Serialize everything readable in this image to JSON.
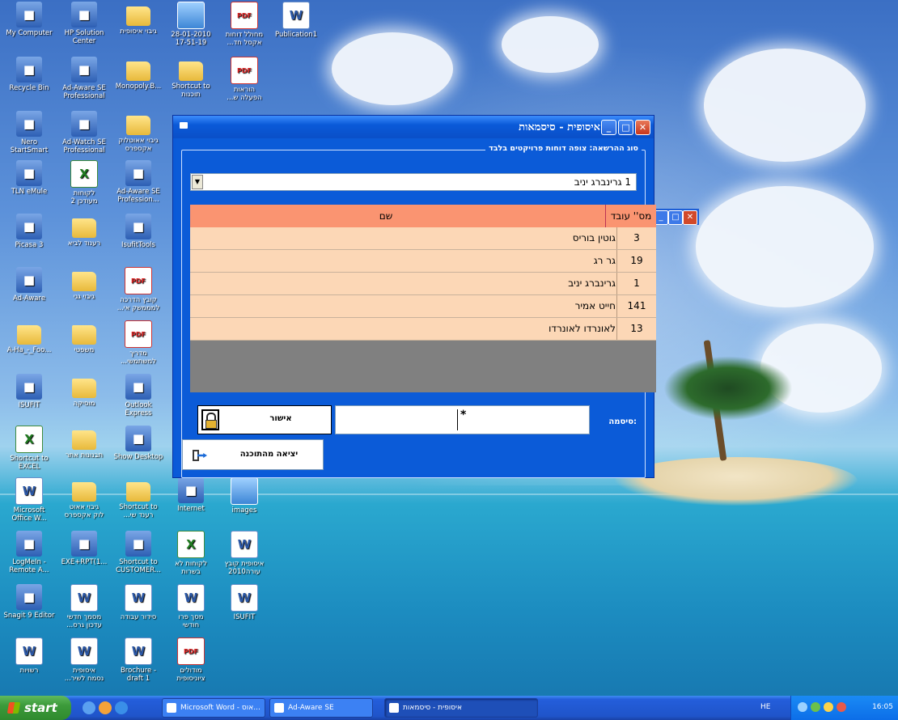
{
  "desktop": {
    "icons": [
      {
        "label": "My Computer",
        "kind": "app"
      },
      {
        "label": "HP Solution\nCenter",
        "kind": "app"
      },
      {
        "label": "גיבוי איסופית",
        "kind": "folder"
      },
      {
        "label": "28-01-2010\n17-51-19",
        "kind": "image"
      },
      {
        "label": "מחולל דוחות\n...אקסל חד",
        "kind": "pdf"
      },
      {
        "label": "Publication1",
        "kind": "doc"
      },
      {
        "label": "Recycle Bin",
        "kind": "app"
      },
      {
        "label": "Ad-Aware SE\nProfessional",
        "kind": "app"
      },
      {
        "label": "Monopoly.B...",
        "kind": "folder"
      },
      {
        "label": "Shortcut to\nתוכנות",
        "kind": "folder"
      },
      {
        "label": "הוראות\n...הפעלה ש",
        "kind": "pdf"
      },
      {
        "label": "Nero\nStartSmart",
        "kind": "app"
      },
      {
        "label": "Ad-Watch SE\nProfessional",
        "kind": "app"
      },
      {
        "label": "גיבוי אאוטלוק\nאקספרס",
        "kind": "folder"
      },
      {
        "label": "TLN eMule",
        "kind": "app"
      },
      {
        "label": "לקוחות\nמעודכן 2",
        "kind": "excel"
      },
      {
        "label": "Ad-Aware SE\nProfession...",
        "kind": "app"
      },
      {
        "label": "Picasa 3",
        "kind": "app"
      },
      {
        "label": "רענוד לביא",
        "kind": "folder"
      },
      {
        "label": "IsufitTools",
        "kind": "app"
      },
      {
        "label": "Ad-Aware",
        "kind": "app"
      },
      {
        "label": "גיבוי גגי",
        "kind": "folder"
      },
      {
        "label": "קובץ הדרכה\n...למממשק אי",
        "kind": "pdf"
      },
      {
        "label": "A-Ha_-_Foo...",
        "kind": "folder"
      },
      {
        "label": "משפטי",
        "kind": "folder"
      },
      {
        "label": "מדריך\n...למשתמשי",
        "kind": "pdf"
      },
      {
        "label": "ISUFIT",
        "kind": "app"
      },
      {
        "label": "מוסיקה",
        "kind": "folder"
      },
      {
        "label": "Outlook\nExpress",
        "kind": "app"
      },
      {
        "label": "Shortcut to\nEXCEL",
        "kind": "excel"
      },
      {
        "label": "תבנונות אתר",
        "kind": "folder"
      },
      {
        "label": "Show Desktop",
        "kind": "app"
      },
      {
        "label": "Microsoft\nOffice W...",
        "kind": "doc"
      },
      {
        "label": "גיבוי אאוט\nלוק אקספרס",
        "kind": "folder"
      },
      {
        "label": "Shortcut to\n...רענד שי",
        "kind": "folder"
      },
      {
        "label": "Internet",
        "kind": "app"
      },
      {
        "label": "images",
        "kind": "image"
      },
      {
        "label": "LogMeIn -\nRemote A...",
        "kind": "app"
      },
      {
        "label": "EXE+RPT(1...",
        "kind": "app"
      },
      {
        "label": "Shortcut to\nCUSTOMER...",
        "kind": "app"
      },
      {
        "label": "לקוחות לא\nבשרות",
        "kind": "excel"
      },
      {
        "label": "איסופית קובץ\nעורה2010",
        "kind": "doc"
      },
      {
        "label": "Snagit 9 Editor",
        "kind": "app"
      },
      {
        "label": "מסמך חדשי\n...עדכון גרס",
        "kind": "doc"
      },
      {
        "label": "סידור עבודה",
        "kind": "doc"
      },
      {
        "label": "מסך פרו\nחודשי",
        "kind": "doc"
      },
      {
        "label": "ISUFIT",
        "kind": "doc"
      },
      {
        "label": "רשויות",
        "kind": "doc"
      },
      {
        "label": "איסופית\n...נסמח לשיר",
        "kind": "doc"
      },
      {
        "label": "Brochure -\ndraft 1",
        "kind": "doc"
      },
      {
        "label": "מודולים\nציוניסופית",
        "kind": "pdf"
      }
    ]
  },
  "window": {
    "title": "איסופית - סיסמאות",
    "close_glyph": "✕",
    "max_glyph": "□",
    "min_glyph": "_",
    "group_label": "סוג ההרשאה:  צופה דוחות פרויקטים בלבד",
    "combo": {
      "value": "1 גרינברג יניב",
      "arrow": "▼"
    },
    "table": {
      "columns": [
        "מס'' עובד",
        "שם"
      ],
      "rows": [
        {
          "num": "3",
          "name": "גוטין בוריס"
        },
        {
          "num": "19",
          "name": "גר רג"
        },
        {
          "num": "1",
          "name": "גרינברג יניב"
        },
        {
          "num": "141",
          "name": "חייט אמיר"
        },
        {
          "num": "13",
          "name": "לאונרדו לאונרדו"
        }
      ]
    },
    "password_label": "סיסמה:",
    "password_value": "*",
    "ok_label": "אישור",
    "exit_label": "יציאה מהתוכנה"
  },
  "taskbar": {
    "start_label": "start",
    "tasks": [
      {
        "label": "Microsoft Word - אוס...",
        "active": false
      },
      {
        "label": "Ad-Aware SE",
        "active": false
      },
      {
        "label": "איסופית - סיסמאות",
        "active": true
      }
    ],
    "lang": "HE",
    "clock": "16:05"
  },
  "colors": {
    "window_blue": "#0a5ad8",
    "grid_header": "#fa9471",
    "grid_row": "#fcd7b6",
    "grid_empty": "#808080"
  }
}
